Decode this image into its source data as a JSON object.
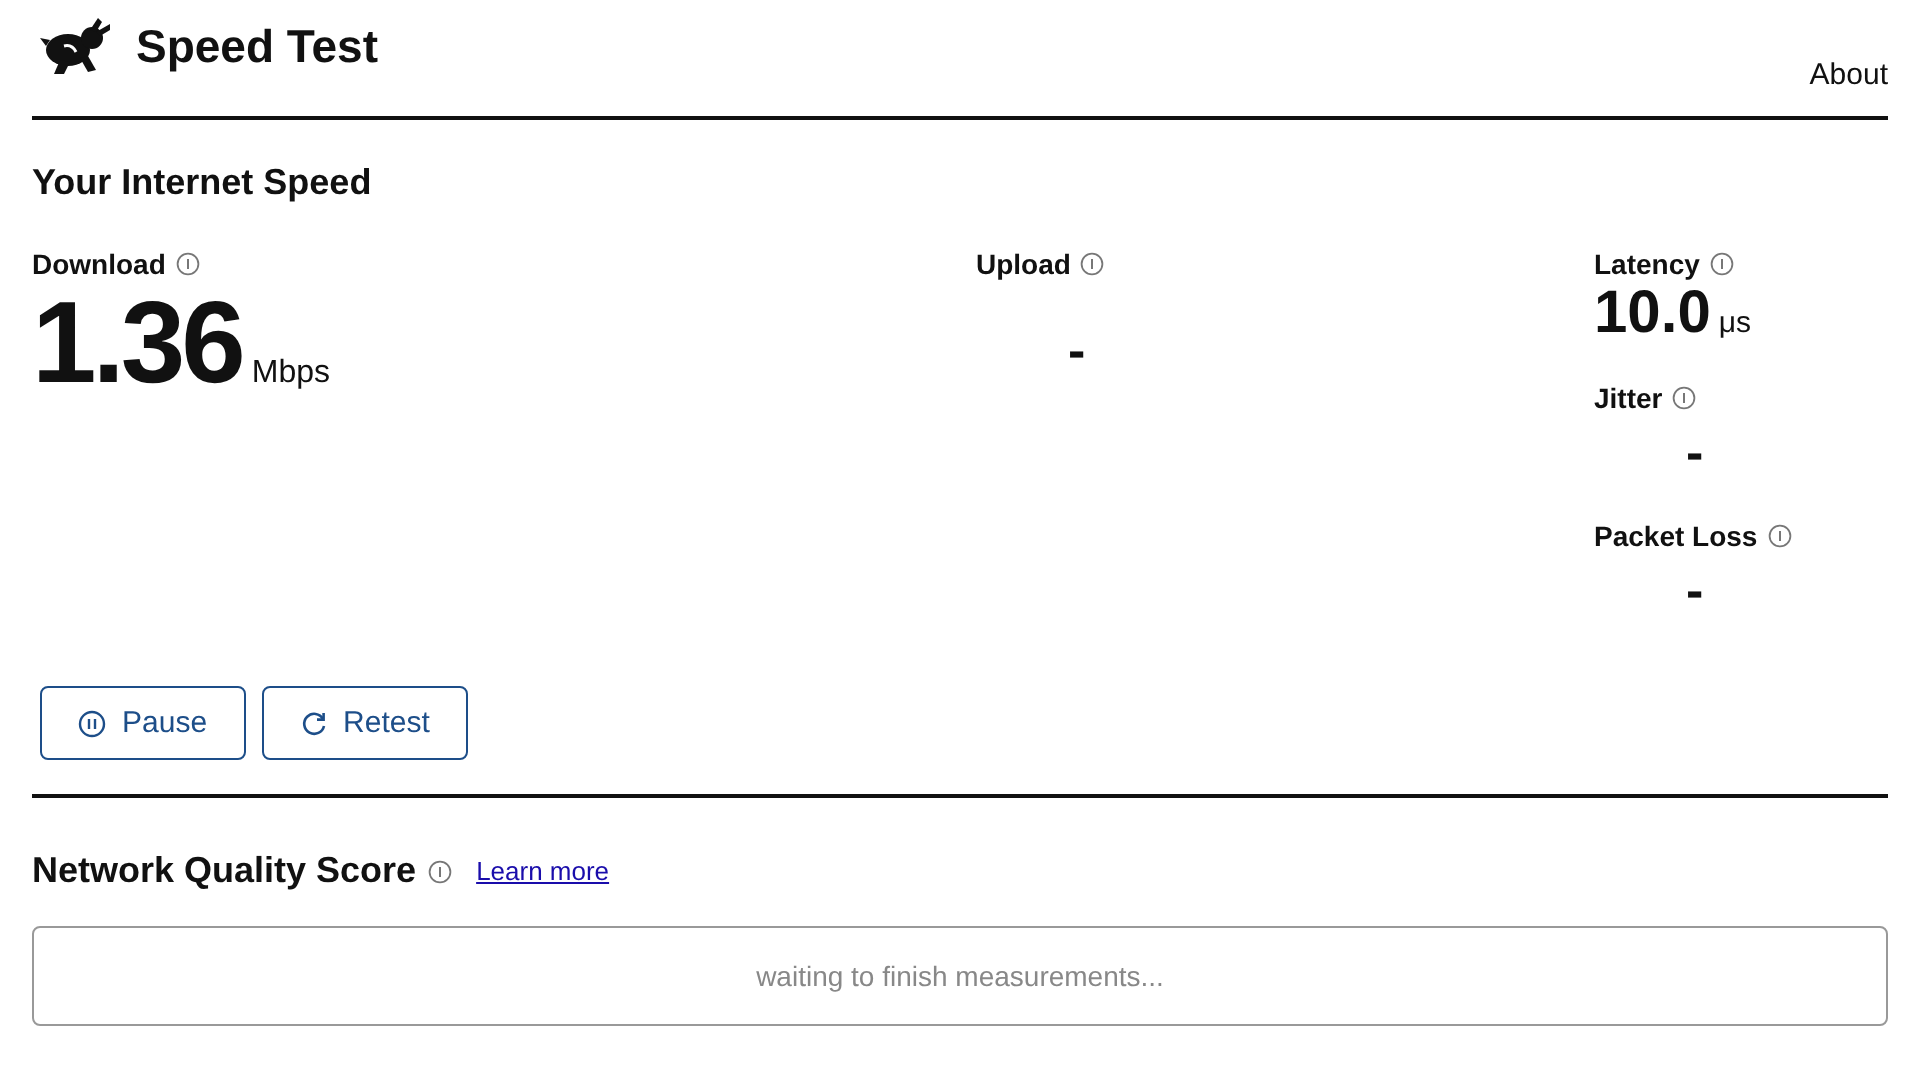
{
  "header": {
    "title": "Speed Test",
    "about": "About"
  },
  "section_title": "Your Internet Speed",
  "download": {
    "label": "Download",
    "value": "1.36",
    "unit": "Mbps"
  },
  "upload": {
    "label": "Upload",
    "value": "-"
  },
  "side_metrics": [
    {
      "label": "Latency",
      "value": "10.0",
      "unit": "μs"
    },
    {
      "label": "Jitter",
      "value": "-"
    },
    {
      "label": "Packet Loss",
      "value": "-"
    }
  ],
  "buttons": [
    {
      "kind": "pause",
      "label": "Pause"
    },
    {
      "kind": "retest",
      "label": "Retest"
    }
  ],
  "quality": {
    "title": "Network Quality Score",
    "link": "Learn more",
    "status": "waiting to finish measurements..."
  }
}
